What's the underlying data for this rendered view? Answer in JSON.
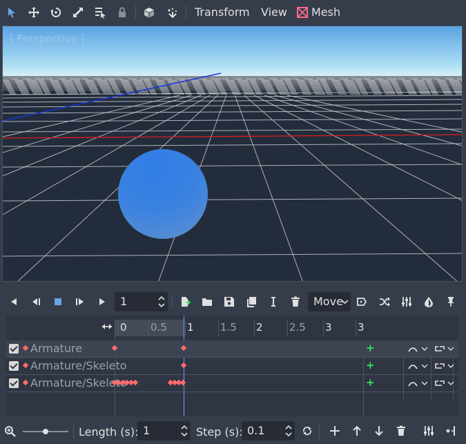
{
  "toolbar": {
    "icons": [
      "select-icon",
      "move-icon",
      "rotate-icon",
      "scale-icon",
      "list-select-icon",
      "lock-icon",
      "cube-icon",
      "snap-icon"
    ],
    "menus": {
      "transform": "Transform",
      "view": "View",
      "mesh": "Mesh"
    }
  },
  "viewport": {
    "label": "[ Perspective ]",
    "sky_top": "#3f9be0",
    "sky_bottom": "#c7e9f8",
    "ground": "#232c3a",
    "sphere": "#4b8ee8"
  },
  "animation": {
    "frame_value": "1",
    "track_mode": "Move",
    "ruler_labels": [
      "0",
      "0.5",
      "1",
      "1.5",
      "2",
      "2.5",
      "3",
      "3"
    ],
    "tracks": [
      {
        "name": "Armature"
      },
      {
        "name": "Armature/Skeleto"
      },
      {
        "name": "Armature/Skeleto"
      }
    ]
  },
  "bottom": {
    "length_label": "Length (s):",
    "length_value": "1",
    "step_label": "Step (s):",
    "step_value": "0.1"
  },
  "colors": {
    "accent": "#6ea3e8",
    "key": "#ff6b6b",
    "add": "#2ee85c",
    "panel": "#363d4a"
  }
}
